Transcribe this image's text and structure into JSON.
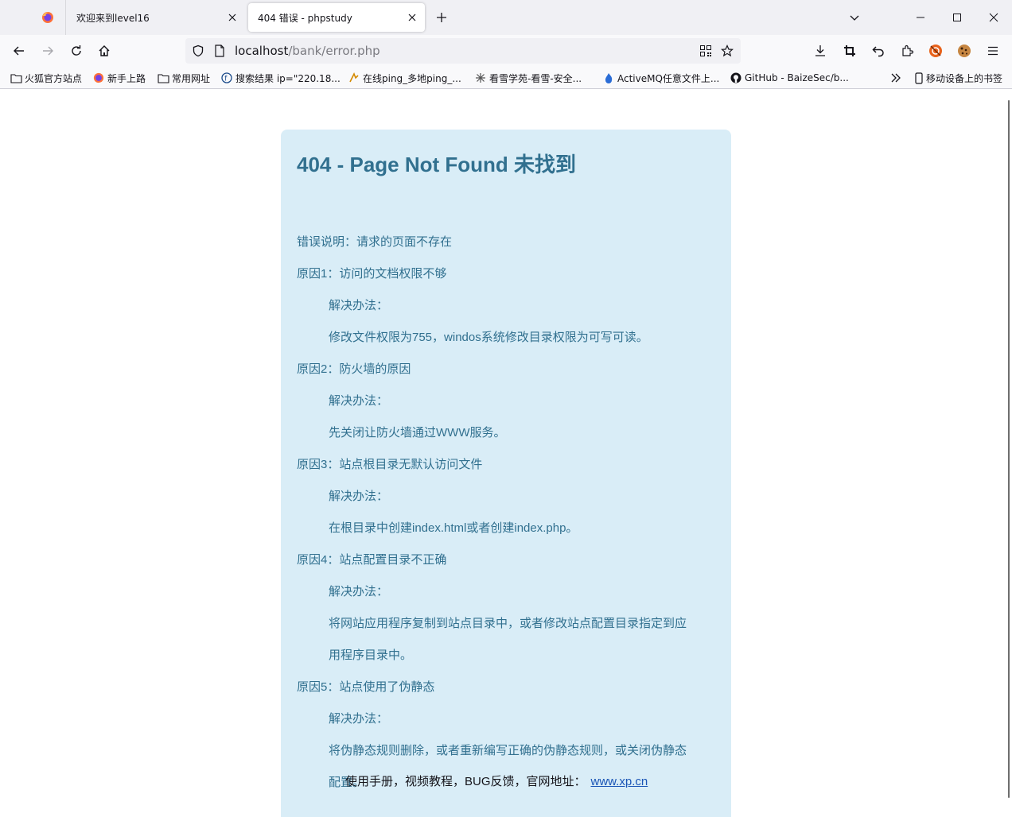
{
  "tabs": [
    {
      "title": "欢迎来到level16",
      "active": false
    },
    {
      "title": "404 错误 - phpstudy",
      "active": true
    }
  ],
  "navbar": {
    "url_host": "localhost",
    "url_path": "/bank/error.php"
  },
  "bookmarks": [
    {
      "label": "火狐官方站点",
      "icon": "folder-icon"
    },
    {
      "label": "新手上路",
      "icon": "firefox-icon"
    },
    {
      "label": "常用网址",
      "icon": "folder-icon"
    },
    {
      "label": "搜索结果 ip=\"220.18...",
      "icon": "fofa-icon"
    },
    {
      "label": "在线ping_多地ping_...",
      "icon": "ping-icon"
    },
    {
      "label": "看雪学苑-看雪-安全...",
      "icon": "kanxue-icon"
    },
    {
      "label": "ActiveMQ任意文件上...",
      "icon": "flame-icon"
    },
    {
      "label": "GitHub - BaizeSec/b...",
      "icon": "github-icon"
    }
  ],
  "mobile_bookmarks": "移动设备上的书签",
  "error": {
    "title": "404 - Page Not Found 未找到",
    "lines": [
      "错误说明：请求的页面不存在",
      "原因1：访问的文档权限不够",
      "解决办法：",
      "修改文件权限为755，windos系统修改目录权限为可写可读。",
      "原因2：防火墙的原因",
      "解决办法：",
      "先关闭让防火墙通过WWW服务。",
      "原因3：站点根目录无默认访问文件",
      "解决办法：",
      "在根目录中创建index.html或者创建index.php。",
      "原因4：站点配置目录不正确",
      "解决办法：",
      "将网站应用程序复制到站点目录中，或者修改站点配置目录指定到应",
      "用程序目录中。",
      "原因5：站点使用了伪静态",
      "解决办法：",
      "将伪静态规则删除，或者重新编写正确的伪静态规则，或关闭伪静态",
      "配置。"
    ],
    "footer_text": "使用手册，视频教程，BUG反馈，官网地址：",
    "footer_link": "www.xp.cn"
  },
  "colors": {
    "box_bg": "#d9edf7",
    "text": "#31708f",
    "link": "#1a55b6"
  }
}
